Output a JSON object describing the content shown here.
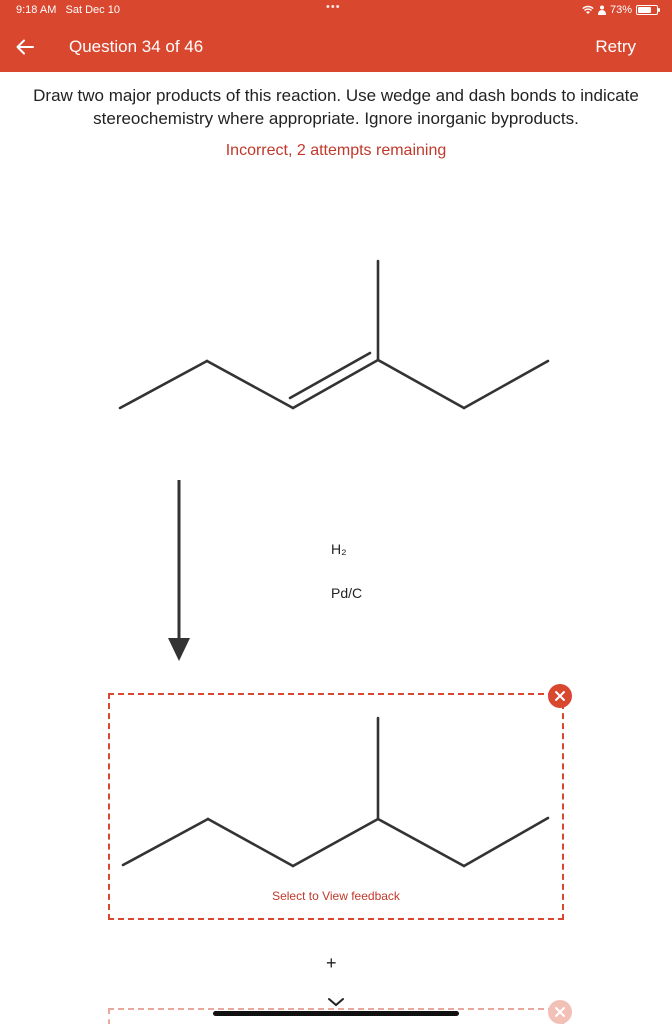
{
  "status_bar": {
    "time": "9:18 AM",
    "date": "Sat Dec 10",
    "dots": "•••",
    "battery_percent": "73%",
    "battery_level": 0.73
  },
  "header": {
    "back_icon": "arrow-left-icon",
    "title": "Question 34 of 46",
    "retry_label": "Retry"
  },
  "question": {
    "prompt": "Draw two major products of this reaction. Use wedge and dash bonds to indicate stereochemistry where appropriate. Ignore inorganic byproducts.",
    "status": "Incorrect, 2 attempts remaining"
  },
  "reaction": {
    "reagent_1": "H₂",
    "reagent_2": "Pd/C"
  },
  "answer": {
    "feedback_link": "Select to View feedback",
    "remove_icon": "close-icon",
    "add_symbol": "+",
    "collapse_icon": "chevron-down-icon"
  },
  "colors": {
    "accent": "#d9472f",
    "error_text": "#c0392b"
  }
}
